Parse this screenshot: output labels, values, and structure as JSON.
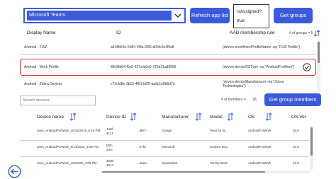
{
  "toolbar": {
    "app_select_value": "Microsoft Teams",
    "refresh_label": "Refresh app list",
    "is_assigned_label": "isAssigned?",
    "is_assigned_value": "true",
    "get_groups_label": "Get groups"
  },
  "groups_table": {
    "headers": {
      "display_name": "Display Name",
      "id": "ID",
      "rule": "AAD membership rule"
    },
    "count_label": "# of groups =",
    "count_value": "5",
    "rows": [
      {
        "name": "Android - FLW",
        "id": "a918b64e-5d84-4f9a-9f36-d09fc3e4f0a8",
        "rule": "(device.enrollmentProfileName -eq \"FLW Profile\")",
        "selected": false
      },
      {
        "name": "Android - Work Profile",
        "id": "8fe08d64-f0c0-437a-b0e0-722d31a86055",
        "rule": "(device.deviceOSType -eq \"AndroidForWork\")",
        "selected": true
      },
      {
        "name": "Android - Zebra Devices",
        "id": "c73cfd8e-3b15-4f61-b02f-aa9c1e8b6d7e",
        "rule": "(device.deviceManufacturer -eq \"Zebra Technologies\")",
        "selected": false
      }
    ]
  },
  "search": {
    "placeholder": "Search devices"
  },
  "members": {
    "count_label": "# of members =",
    "count_value": "36",
    "button_label": "Get group members"
  },
  "devices_table": {
    "headers": {
      "device_name": "Device name",
      "device_id": "Device ID",
      "manufacturer": "Manufacturer",
      "model": "Model",
      "os": "OS",
      "os_ver": "OS Ver"
    },
    "rows": [
      {
        "name": "Jenn_AndroidForWork_10/15/2019_6:15 PM",
        "id": "448f-4121",
        "dot": "...af57-",
        "manufacturer": "Google",
        "model": "Pixel 3a XL",
        "os": "AndroidForWork",
        "ver": "10.0"
      },
      {
        "name": "Jenn_AndroidForWork_9/14/2020_4:06 PM",
        "id": "fd0c-43cc",
        "dot": "...b7fe-",
        "manufacturer": "Microsoft",
        "model": "Surface Duo",
        "os": "AndroidForWork",
        "ver": "10.0"
      },
      {
        "name": "Jenn_AndroidForWork_4/3/2020_4:09 PM",
        "id": "4b0b-4b14",
        "dot": "...a6ee-",
        "manufacturer": "Spectralink",
        "model": "Versity 9540",
        "os": "AndroidForWork",
        "ver": "10.0"
      }
    ]
  },
  "colors": {
    "accent": "#3b5bdb",
    "selection_border": "#e03131"
  },
  "icons": {
    "chevron": "chevron-down-icon",
    "check": "check-circle-icon",
    "sort": "sort-icon",
    "back": "back-arrow-icon"
  }
}
